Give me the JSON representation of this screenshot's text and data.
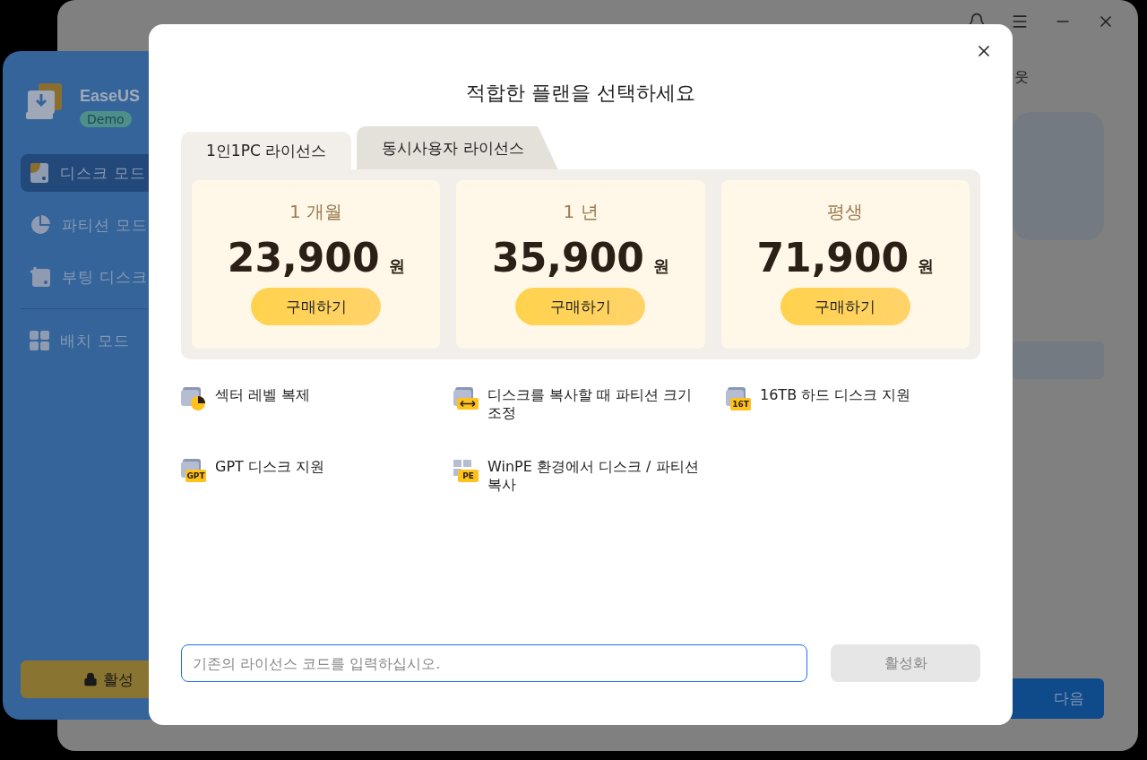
{
  "background_window": {
    "brand": "EaseUS",
    "badge": "Demo",
    "sidebar_groups": [
      {
        "items": [
          {
            "label": "디스크 모드",
            "selected": true,
            "kind": "disk"
          },
          {
            "label": "파티션 모드",
            "selected": false,
            "kind": "pie"
          },
          {
            "label": "부팅 디스크",
            "selected": false,
            "kind": "boot"
          }
        ]
      },
      {
        "items": [
          {
            "label": "배치 모드",
            "selected": false,
            "kind": "grid"
          }
        ]
      }
    ],
    "activate_button": "활성",
    "header_text": "웃",
    "next_button": "다음"
  },
  "dialog": {
    "title": "적합한 플랜을 선택하세요",
    "tabs": [
      {
        "label": "1인1PC 라이선스",
        "selected": true
      },
      {
        "label": "동시사용자 라이선스",
        "selected": false
      }
    ],
    "plans": [
      {
        "period": "1 개월",
        "price": "23,900",
        "currency": "원",
        "button": "구매하기"
      },
      {
        "period": "1 년",
        "price": "35,900",
        "currency": "원",
        "button": "구매하기"
      },
      {
        "period": "평생",
        "price": "71,900",
        "currency": "원",
        "button": "구매하기"
      }
    ],
    "features": [
      {
        "label": "섹터 레벨 복제",
        "kind": "sector"
      },
      {
        "label": "디스크를 복사할 때 파티션 크기 조정",
        "kind": "resize"
      },
      {
        "label": "16TB 하드 디스크 지원",
        "kind": "badge",
        "badge": "16T"
      },
      {
        "label": "GPT 디스크 지원",
        "kind": "badge",
        "badge": "GPT"
      },
      {
        "label": "WinPE 환경에서 디스크 / 파티션 복사",
        "kind": "windows",
        "badge": "PE"
      }
    ],
    "license_field": {
      "placeholder": "기존의 라이선스 코드를 입력하십시오."
    },
    "activate_button": {
      "label": "활성화",
      "disabled": true
    }
  }
}
